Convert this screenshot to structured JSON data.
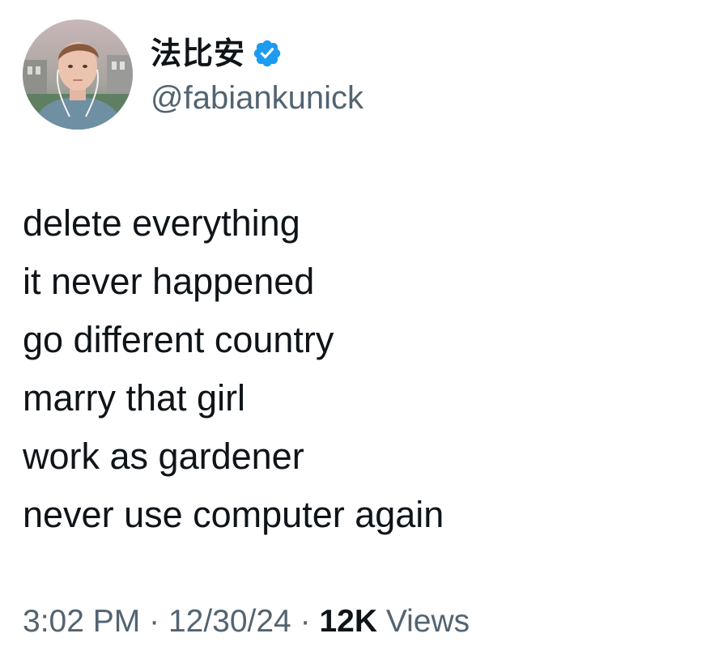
{
  "author": {
    "display_name": "法比安",
    "handle": "@fabiankunick",
    "verified": true,
    "avatar_icon": "profile-photo",
    "verified_icon": "verified-badge-icon",
    "verified_color": "#1d9bf0"
  },
  "tweet": {
    "lines": [
      "delete everything",
      "it never happened",
      "go different country",
      "marry that girl",
      "work as gardener",
      "never use computer again"
    ]
  },
  "meta": {
    "time": "3:02 PM",
    "separator": "·",
    "date": "12/30/24",
    "views_count": "12K",
    "views_label": "Views"
  }
}
